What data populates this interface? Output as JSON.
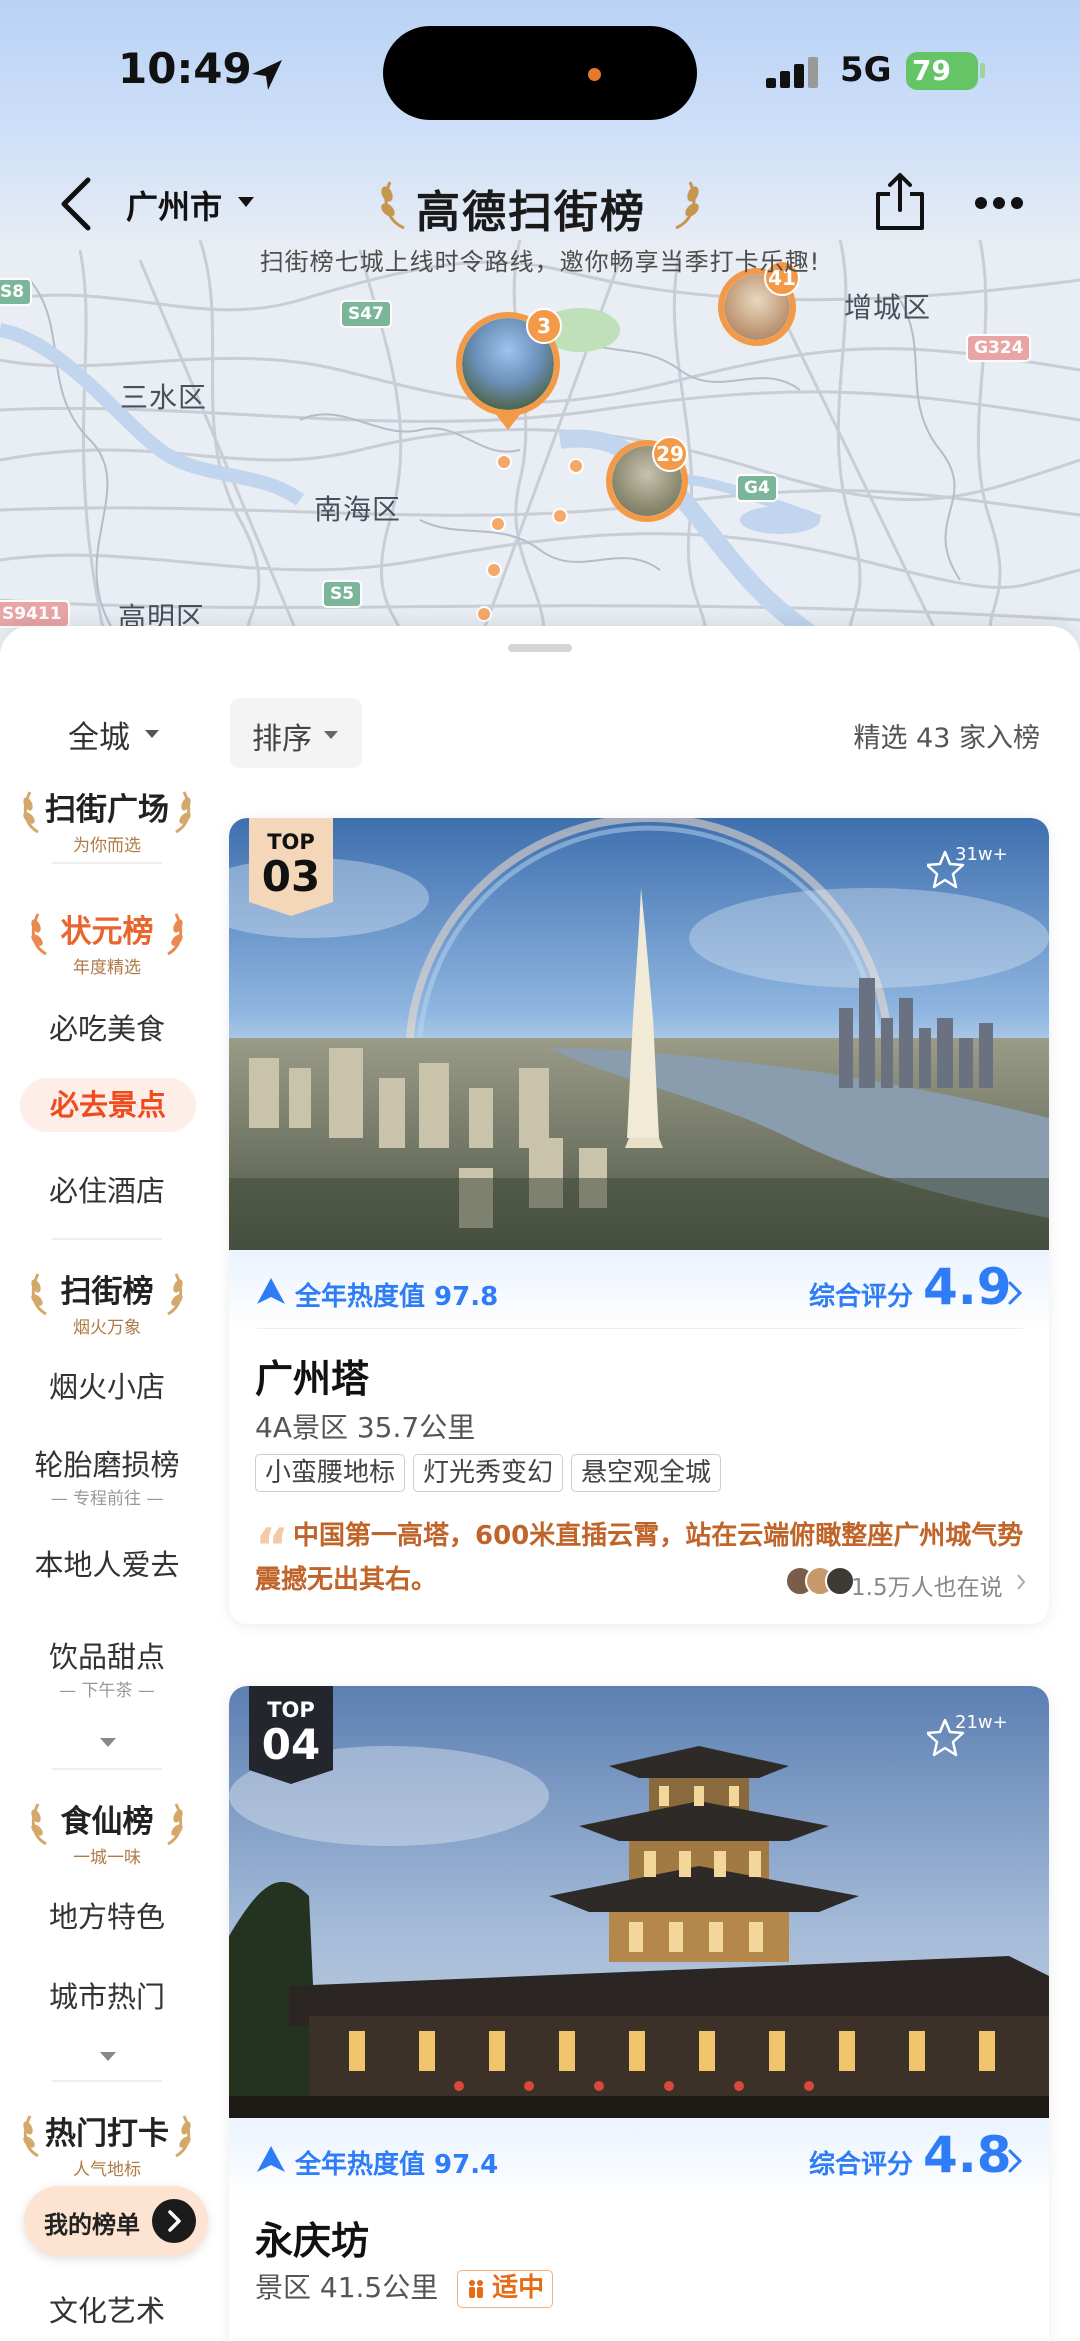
{
  "status": {
    "time": "10:49",
    "network": "5G",
    "battery": "79"
  },
  "header": {
    "city": "广州市",
    "title": "高德扫街榜",
    "subtitle": "扫街榜七城上线时令路线，邀你畅享当季打卡乐趣!"
  },
  "map": {
    "labels": [
      "三水区",
      "南海区",
      "增城区",
      "高明区"
    ],
    "road_badges": [
      "S8",
      "S47",
      "G324",
      "G4",
      "S5",
      "S9411"
    ],
    "pins": [
      "3",
      "29",
      "41"
    ]
  },
  "filters": {
    "area": "全城",
    "sort": "排序",
    "count": "精选 43 家入榜"
  },
  "sidebar": {
    "sections": [
      {
        "title": "扫街广场",
        "sub": "为你而选"
      },
      {
        "title": "状元榜",
        "sub": "年度精选"
      },
      {
        "title": "扫街榜",
        "sub": "烟火万象"
      },
      {
        "title": "食仙榜",
        "sub": "一城一味"
      },
      {
        "title": "热门打卡",
        "sub": "人气地标"
      }
    ],
    "items": [
      "必吃美食",
      "必去景点",
      "必住酒店",
      "烟火小店",
      "轮胎磨损榜",
      "本地人爱去",
      "饮品甜点",
      "地方特色",
      "城市热门",
      "文化艺术"
    ],
    "item_subs": [
      "专程前往",
      "下午茶"
    ],
    "active": "必去景点"
  },
  "cards": [
    {
      "rank_label": "TOP",
      "rank": "03",
      "fav_count": "31w+",
      "heat": "全年热度值 97.8",
      "score_label": "综合评分",
      "score": "4.9",
      "name": "广州塔",
      "meta": "4A景区  35.7公里",
      "tags": [
        "小蛮腰地标",
        "灯光秀变幻",
        "悬空观全城"
      ],
      "quote": "中国第一高塔，600米直插云霄，站在云端俯瞰整座广州城气势震撼无出其右。",
      "talk": "1.5万人也在说"
    },
    {
      "rank_label": "TOP",
      "rank": "04",
      "fav_count": "21w+",
      "heat": "全年热度值 97.4",
      "score_label": "综合评分",
      "score": "4.8",
      "name": "永庆坊",
      "meta": "景区  41.5公里",
      "fit": "适中"
    }
  ],
  "my_list": {
    "label": "我的榜单"
  },
  "colors": {
    "accent_blue": "#2e7cf6",
    "accent_orange": "#f04a1f",
    "map_pin": "#f39a49"
  }
}
